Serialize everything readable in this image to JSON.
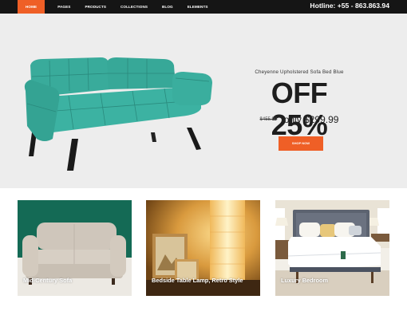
{
  "nav": {
    "items": [
      "Home",
      "Pages",
      "Products",
      "Collections",
      "Blog",
      "Elements"
    ],
    "active_index": 0
  },
  "header": {
    "hotline": "Hotline: +55 - 863.863.94"
  },
  "hero": {
    "subtitle": "Cheyenne Upholstered Sofa Bed Blue",
    "title": "OFF 25%",
    "old_price": "$455.99",
    "new_price": "only $299.99",
    "button_label": "SHOP NOW"
  },
  "categories": [
    {
      "label": "Mid-Century Sofa"
    },
    {
      "label": "Bedside Table Lamp, Retro Style"
    },
    {
      "label": "Luxury Bedroom"
    }
  ],
  "colors": {
    "accent": "#ef5f26",
    "topbar": "#151515",
    "hero_bg": "#ededed",
    "sofa": "#3bb0a0"
  }
}
